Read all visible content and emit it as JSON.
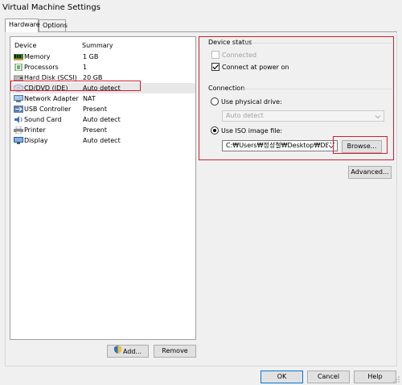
{
  "window": {
    "title": "Virtual Machine Settings"
  },
  "tabs": [
    {
      "label": "Hardware",
      "active": true
    },
    {
      "label": "Options",
      "active": false
    }
  ],
  "device_list": {
    "headers": {
      "device": "Device",
      "summary": "Summary"
    },
    "items": [
      {
        "name": "Memory",
        "summary": "1 GB",
        "icon": "memory-icon",
        "selected": false
      },
      {
        "name": "Processors",
        "summary": "1",
        "icon": "processor-icon",
        "selected": false
      },
      {
        "name": "Hard Disk (SCSI)",
        "summary": "20 GB",
        "icon": "hard-disk-icon",
        "selected": false
      },
      {
        "name": "CD/DVD (IDE)",
        "summary": "Auto detect",
        "icon": "cd-dvd-icon",
        "selected": true
      },
      {
        "name": "Network Adapter",
        "summary": "NAT",
        "icon": "network-adapter-icon",
        "selected": false
      },
      {
        "name": "USB Controller",
        "summary": "Present",
        "icon": "usb-icon",
        "selected": false
      },
      {
        "name": "Sound Card",
        "summary": "Auto detect",
        "icon": "sound-card-icon",
        "selected": false
      },
      {
        "name": "Printer",
        "summary": "Present",
        "icon": "printer-icon",
        "selected": false
      },
      {
        "name": "Display",
        "summary": "Auto detect",
        "icon": "display-icon",
        "selected": false
      }
    ]
  },
  "device_status": {
    "label": "Device status",
    "connected": {
      "label": "Connected",
      "checked": false,
      "enabled": false
    },
    "connect_at_power_on": {
      "label": "Connect at power on",
      "checked": true,
      "enabled": true
    }
  },
  "connection": {
    "label": "Connection",
    "use_physical_drive": {
      "label": "Use physical drive:",
      "selected": false
    },
    "physical_drive_value": "Auto detect",
    "use_iso_image": {
      "label": "Use ISO image file:",
      "selected": true
    },
    "iso_path": "C:₩Users₩정성철₩Desktop₩DBM",
    "browse_label": "Browse..."
  },
  "advanced_label": "Advanced...",
  "add_label": "Add...",
  "remove_label": "Remove",
  "footer": {
    "ok": "OK",
    "cancel": "Cancel",
    "help": "Help"
  },
  "colors": {
    "highlight_red": "#d21f2c",
    "primary_blue": "#0078d7"
  }
}
